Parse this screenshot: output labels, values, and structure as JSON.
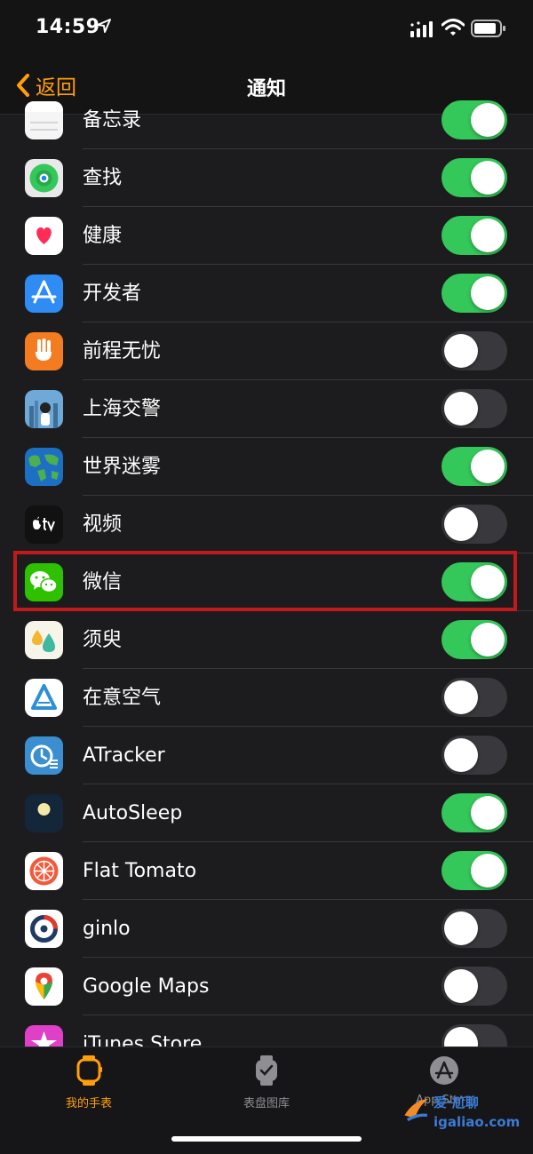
{
  "status": {
    "time": "14:59"
  },
  "nav": {
    "back_label": "返回",
    "title": "通知"
  },
  "rows": [
    {
      "label": "备忘录",
      "icon": "notes-icon",
      "on": true
    },
    {
      "label": "查找",
      "icon": "find-my-icon",
      "on": true
    },
    {
      "label": "健康",
      "icon": "health-icon",
      "on": true
    },
    {
      "label": "开发者",
      "icon": "developer-icon",
      "on": true
    },
    {
      "label": "前程无忧",
      "icon": "51job-icon",
      "on": false
    },
    {
      "label": "上海交警",
      "icon": "shanghai-traffic-police-icon",
      "on": false
    },
    {
      "label": "世界迷雾",
      "icon": "fog-of-world-icon",
      "on": true
    },
    {
      "label": "视频",
      "icon": "apple-tv-icon",
      "on": false
    },
    {
      "label": "微信",
      "icon": "wechat-icon",
      "on": true
    },
    {
      "label": "须臾",
      "icon": "xuyu-icon",
      "on": true
    },
    {
      "label": "在意空气",
      "icon": "air-matters-icon",
      "on": false
    },
    {
      "label": "ATracker",
      "icon": "atracker-icon",
      "on": false
    },
    {
      "label": "AutoSleep",
      "icon": "autosleep-icon",
      "on": true
    },
    {
      "label": "Flat Tomato",
      "icon": "flat-tomato-icon",
      "on": true
    },
    {
      "label": "ginlo",
      "icon": "ginlo-icon",
      "on": false
    },
    {
      "label": "Google Maps",
      "icon": "google-maps-icon",
      "on": false
    },
    {
      "label": "iTunes Store",
      "icon": "itunes-store-icon",
      "on": false
    }
  ],
  "tabs": [
    {
      "label": "我的手表",
      "icon": "watch-icon",
      "active": true
    },
    {
      "label": "表盘图库",
      "icon": "face-gallery-icon",
      "active": false
    },
    {
      "label": "App Store",
      "icon": "app-store-icon",
      "active": false
    }
  ],
  "watermark": "爱·尬聊 igaliao.com",
  "colors": {
    "accent": "#ff9f0a",
    "toggle_on": "#34c759",
    "toggle_off": "#39393d",
    "background": "#1c1c1e",
    "highlight": "#c21a1a"
  }
}
